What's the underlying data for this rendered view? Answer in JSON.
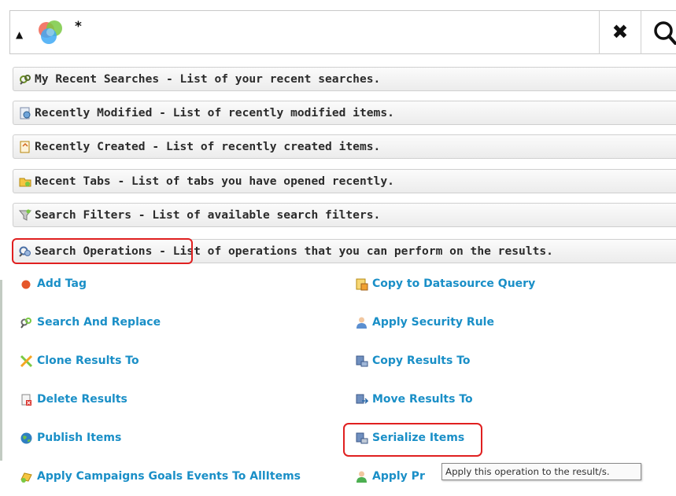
{
  "search": {
    "query": "*"
  },
  "sections": [
    {
      "name": "My Recent Searches",
      "desc": " - List of your recent searches.",
      "icon": "recent-searches-icon"
    },
    {
      "name": "Recently Modified",
      "desc": " - List of recently modified items.",
      "icon": "recently-modified-icon"
    },
    {
      "name": "Recently Created",
      "desc": " - List of recently created items.",
      "icon": "recently-created-icon"
    },
    {
      "name": "Recent Tabs",
      "desc": " - List of tabs you have opened recently.",
      "icon": "recent-tabs-icon"
    },
    {
      "name": "Search Filters",
      "desc": " - List of available search filters.",
      "icon": "filter-icon"
    },
    {
      "name": "Search Operations",
      "desc": " - List of operations that you can perform on the results.",
      "icon": "search-operations-icon"
    }
  ],
  "operations": {
    "left": [
      {
        "label": "Add Tag",
        "icon": "tag-dot-icon"
      },
      {
        "label": "Search And Replace",
        "icon": "search-replace-icon"
      },
      {
        "label": "Clone Results To",
        "icon": "clone-icon"
      },
      {
        "label": "Delete Results",
        "icon": "delete-icon"
      },
      {
        "label": "Publish Items",
        "icon": "globe-icon"
      },
      {
        "label": "Apply Campaigns Goals Events To AllItems",
        "icon": "campaign-icon"
      }
    ],
    "right": [
      {
        "label": "Copy to Datasource Query",
        "icon": "datasource-icon"
      },
      {
        "label": "Apply Security Rule",
        "icon": "security-user-icon"
      },
      {
        "label": "Copy Results To",
        "icon": "copy-results-icon"
      },
      {
        "label": "Move Results To",
        "icon": "move-results-icon"
      },
      {
        "label": "Serialize Items",
        "icon": "serialize-icon"
      },
      {
        "label": "Apply Pr",
        "icon": "apply-profile-icon"
      }
    ]
  },
  "tooltip": {
    "text": "Apply this operation to the result/s."
  },
  "colors": {
    "link": "#1a8fc7",
    "highlight": "#e02020"
  }
}
